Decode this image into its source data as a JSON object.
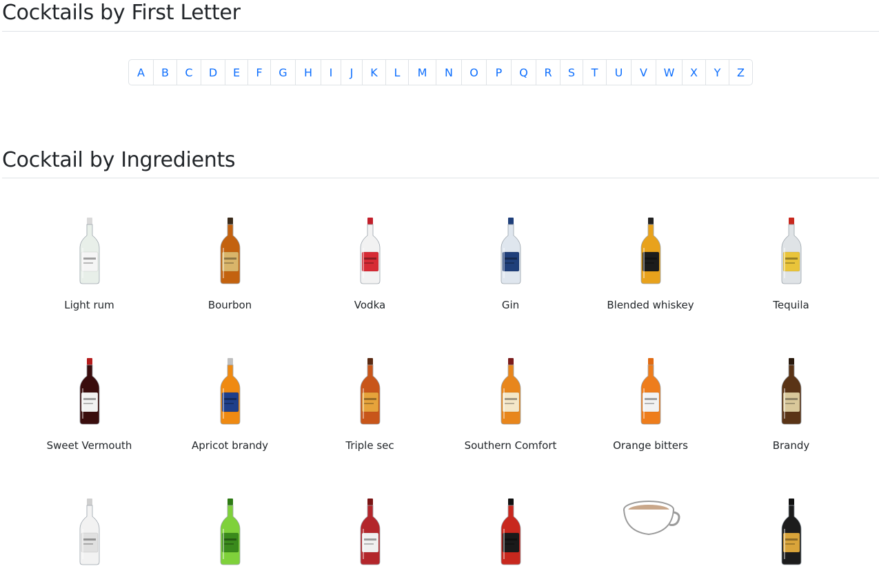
{
  "letters_section": {
    "title": "Cocktails by First Letter",
    "letters": [
      "A",
      "B",
      "C",
      "D",
      "E",
      "F",
      "G",
      "H",
      "I",
      "J",
      "K",
      "L",
      "M",
      "N",
      "O",
      "P",
      "Q",
      "R",
      "S",
      "T",
      "U",
      "V",
      "W",
      "X",
      "Y",
      "Z"
    ]
  },
  "ingredients_section": {
    "title": "Cocktail by Ingredients",
    "items": [
      {
        "label": "Light rum",
        "icon": "light-rum-bottle-icon",
        "glass": "#e8efe9",
        "label_color": "#f5f5f5",
        "cap": "#d9d9d9"
      },
      {
        "label": "Bourbon",
        "icon": "bourbon-bottle-icon",
        "glass": "#c3620f",
        "label_color": "#d9b56a",
        "cap": "#3a2a1a"
      },
      {
        "label": "Vodka",
        "icon": "vodka-bottle-icon",
        "glass": "#f2f2f2",
        "label_color": "#d62b35",
        "cap": "#c21f2b"
      },
      {
        "label": "Gin",
        "icon": "gin-bottle-icon",
        "glass": "#dfe6ee",
        "label_color": "#1f3f7a",
        "cap": "#1f3f7a"
      },
      {
        "label": "Blended whiskey",
        "icon": "blended-whiskey-bottle-icon",
        "glass": "#e8a21c",
        "label_color": "#1c1c1c",
        "cap": "#222222"
      },
      {
        "label": "Tequila",
        "icon": "tequila-bottle-icon",
        "glass": "#dfe3e6",
        "label_color": "#e9c43a",
        "cap": "#c8281e"
      },
      {
        "label": "Sweet Vermouth",
        "icon": "sweet-vermouth-bottle-icon",
        "glass": "#3a0d0d",
        "label_color": "#f2f2f2",
        "cap": "#b51d1d"
      },
      {
        "label": "Apricot brandy",
        "icon": "apricot-brandy-bottle-icon",
        "glass": "#ef8a12",
        "label_color": "#1f3f8a",
        "cap": "#bfbfbf"
      },
      {
        "label": "Triple sec",
        "icon": "triple-sec-bottle-icon",
        "glass": "#c8561a",
        "label_color": "#e6a33b",
        "cap": "#5a2a12"
      },
      {
        "label": "Southern Comfort",
        "icon": "southern-comfort-bottle-icon",
        "glass": "#e8861c",
        "label_color": "#f4e7c8",
        "cap": "#7a1b1b"
      },
      {
        "label": "Orange bitters",
        "icon": "orange-bitters-bottle-icon",
        "glass": "#ee7d1c",
        "label_color": "#f2f2f2",
        "cap": "#e06a12"
      },
      {
        "label": "Brandy",
        "icon": "brandy-bottle-icon",
        "glass": "#5a3416",
        "label_color": "#d9c89a",
        "cap": "#2a1a0d"
      }
    ],
    "partial_row_icons": [
      "white-bottle-icon",
      "green-bottle-icon",
      "red-bottle-icon",
      "red-box-bottle-icon",
      "tea-cup-icon",
      "dark-bottle-icon"
    ]
  }
}
